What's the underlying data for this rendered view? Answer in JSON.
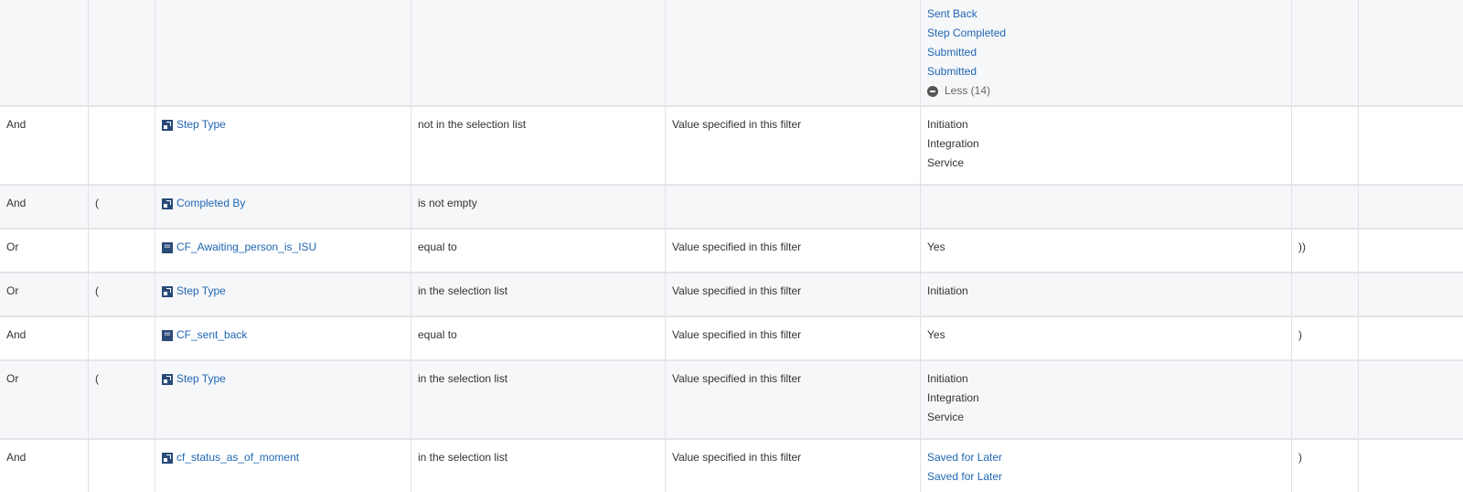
{
  "rows": [
    {
      "values": [
        "Sent Back",
        "Step Completed",
        "Submitted",
        "Submitted"
      ],
      "less_label": "Less (14)"
    },
    {
      "andor": "And",
      "paren_open": "",
      "field": "Step Type",
      "field_icon": "instance-field-icon",
      "operator": "not in the selection list",
      "comparison": "Value specified in this filter",
      "values": [
        "Initiation",
        "Integration",
        "Service"
      ],
      "paren_close": ""
    },
    {
      "andor": "And",
      "paren_open": "(",
      "field": "Completed By",
      "field_icon": "instance-field-icon",
      "operator": "is not empty",
      "comparison": "",
      "values": [],
      "paren_close": ""
    },
    {
      "andor": "Or",
      "paren_open": "",
      "field": "CF_Awaiting_person_is_ISU",
      "field_icon": "calculated-field-icon",
      "operator": "equal to",
      "comparison": "Value specified in this filter",
      "values": [
        "Yes"
      ],
      "paren_close": "))"
    },
    {
      "andor": "Or",
      "paren_open": "(",
      "field": "Step Type",
      "field_icon": "instance-field-icon",
      "operator": "in the selection list",
      "comparison": "Value specified in this filter",
      "values": [
        "Initiation"
      ],
      "paren_close": ""
    },
    {
      "andor": "And",
      "paren_open": "",
      "field": "CF_sent_back",
      "field_icon": "calculated-field-icon",
      "operator": "equal to",
      "comparison": "Value specified in this filter",
      "values": [
        "Yes"
      ],
      "paren_close": ")"
    },
    {
      "andor": "Or",
      "paren_open": "(",
      "field": "Step Type",
      "field_icon": "instance-field-icon",
      "operator": "in the selection list",
      "comparison": "Value specified in this filter",
      "values": [
        "Initiation",
        "Integration",
        "Service"
      ],
      "paren_close": ""
    },
    {
      "andor": "And",
      "paren_open": "",
      "field": "cf_status_as_of_moment",
      "field_icon": "instance-field-icon",
      "operator": "in the selection list",
      "comparison": "Value specified in this filter",
      "values": [
        "Saved for Later",
        "Saved for Later"
      ],
      "paren_close": ")"
    }
  ],
  "colors": {
    "link": "#1f66b3",
    "alt_row": "#f6f7f9",
    "border": "#e3e5e8",
    "field_icon": "#2a4a78"
  }
}
